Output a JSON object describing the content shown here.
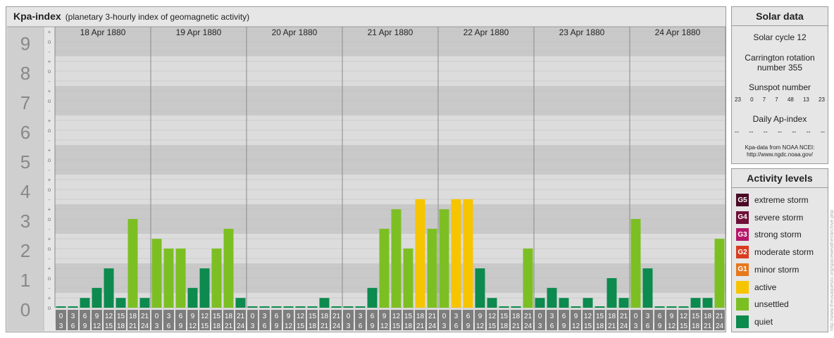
{
  "header": {
    "title": "Kpa-index",
    "subtitle": "(planetary 3-hourly index of geomagnetic activity)"
  },
  "chart_data": {
    "type": "bar",
    "title": "Kpa-index",
    "subtitle": "(planetary 3-hourly index of geomagnetic activity)",
    "ylim": [
      0,
      9
    ],
    "y_ticks": [
      "0",
      "1",
      "2",
      "3",
      "4",
      "5",
      "6",
      "7",
      "8",
      "9"
    ],
    "minor_ticks": [
      "o",
      "+",
      "-"
    ],
    "days": [
      "18 Apr 1880",
      "19 Apr 1880",
      "20 Apr 1880",
      "21 Apr 1880",
      "22 Apr 1880",
      "23 Apr 1880",
      "24 Apr 1880"
    ],
    "interval_top": [
      "0",
      "3",
      "6",
      "9",
      "12",
      "15",
      "18",
      "21"
    ],
    "interval_bottom": [
      "3",
      "6",
      "9",
      "12",
      "15",
      "18",
      "21",
      "24"
    ],
    "values": [
      [
        0,
        0,
        0.33,
        0.67,
        1.33,
        0.33,
        3,
        0.33
      ],
      [
        2.33,
        2,
        2,
        0.67,
        1.33,
        2,
        2.67,
        0.33
      ],
      [
        0,
        0,
        0,
        0,
        0,
        0,
        0.33,
        0
      ],
      [
        0,
        0,
        0.67,
        2.67,
        3.33,
        2,
        3.67,
        2.67
      ],
      [
        3.33,
        3.67,
        3.67,
        1.33,
        0.33,
        0,
        0,
        2
      ],
      [
        0.33,
        0.67,
        0.33,
        0,
        0.33,
        0,
        1,
        0.33
      ],
      [
        3,
        1.33,
        0,
        0,
        0,
        0.33,
        0.33,
        2.33
      ]
    ],
    "colors": {
      "quiet": "#0d8a4e",
      "unsettled": "#7cbf23",
      "active": "#f7c400"
    }
  },
  "solar": {
    "heading": "Solar data",
    "cycle": "Solar cycle 12",
    "carrington_line1": "Carrington rotation",
    "carrington_line2": "number 355",
    "sunspot_label": "Sunspot number",
    "sunspot_values": [
      "23",
      "0",
      "7",
      "7",
      "48",
      "13",
      "23"
    ],
    "ap_label": "Daily Ap-index",
    "ap_values": [
      "--",
      "--",
      "--",
      "--",
      "--",
      "--",
      "--"
    ],
    "source_line1": "Kpa-data from NOAA NCEI:",
    "source_line2": "http://www.ngdc.noaa.gov/"
  },
  "activity": {
    "heading": "Activity levels",
    "levels": [
      {
        "code": "G5",
        "label": "extreme storm",
        "color": "#4a0a24"
      },
      {
        "code": "G4",
        "label": "severe storm",
        "color": "#6f1038"
      },
      {
        "code": "G3",
        "label": "strong storm",
        "color": "#b5176a"
      },
      {
        "code": "G2",
        "label": "moderate storm",
        "color": "#d83c20"
      },
      {
        "code": "G1",
        "label": "minor storm",
        "color": "#e6781e"
      },
      {
        "code": "",
        "label": "active",
        "color": "#f7c400"
      },
      {
        "code": "",
        "label": "unsettled",
        "color": "#7cbf23"
      },
      {
        "code": "",
        "label": "quiet",
        "color": "#0d8a4e"
      }
    ]
  },
  "credit": "http://www.theusaquesto.org/spaceweather/archive.php"
}
